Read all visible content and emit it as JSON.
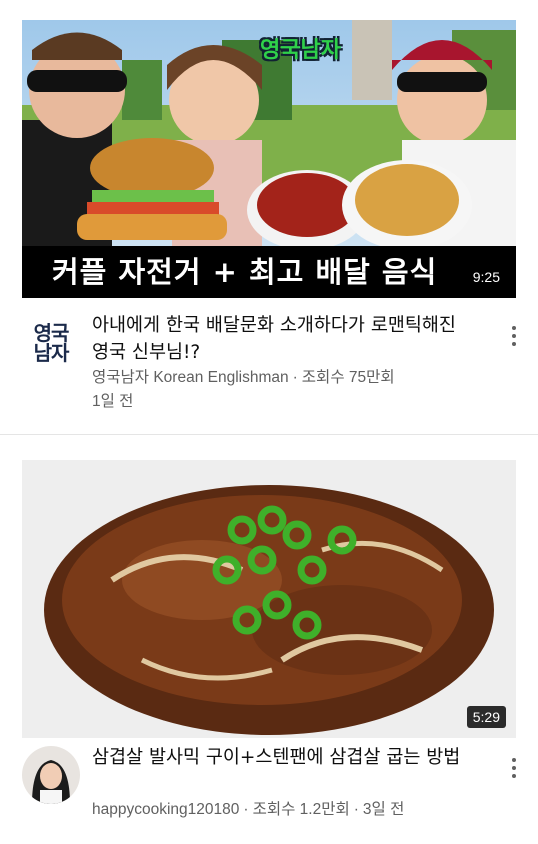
{
  "videos": [
    {
      "thumbnail_text": "커플 자전거 + 최고 배달 음식",
      "watermark": "영국남자",
      "duration": "9:25",
      "channel_logo_line1": "영국",
      "channel_logo_line2": "남자",
      "title": "아내에게 한국 배달문화 소개하다가 로맨틱해진 영국 신부님!?",
      "channel": "영국남자 Korean Englishman",
      "views": "조회수 75만회",
      "age": "1일 전"
    },
    {
      "duration": "5:29",
      "title": "삼겹살 발사믹 구이+스텐팬에 삼겹살 굽는 방법",
      "channel": "happycooking120180",
      "views": "조회수 1.2만회",
      "age": "3일 전"
    }
  ],
  "separator": "·",
  "icons": {
    "menu": "more-vert-icon"
  }
}
